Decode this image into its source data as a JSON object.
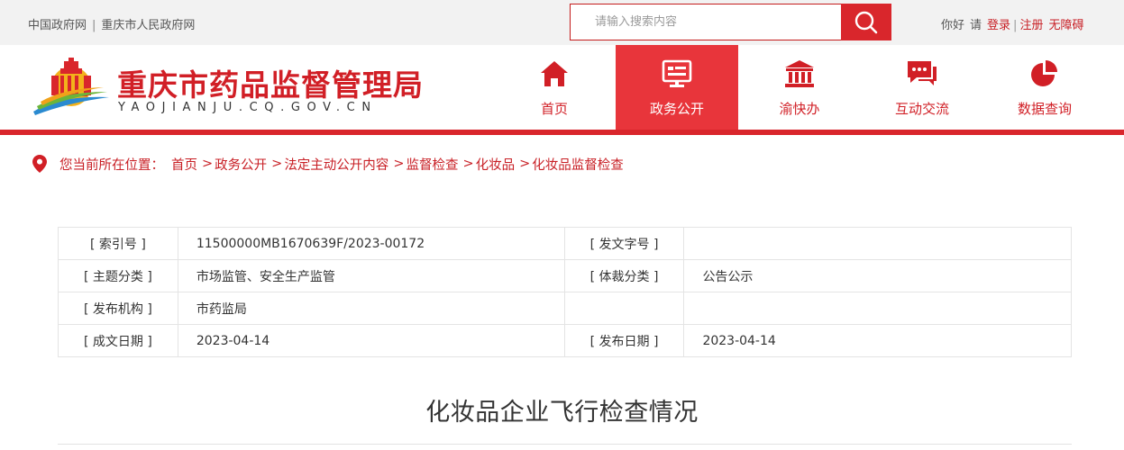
{
  "topbar": {
    "gov_link_1": "中国政府网",
    "gov_separator": "|",
    "gov_link_2": "重庆市人民政府网",
    "search": {
      "placeholder": "请输入搜索内容"
    },
    "user": {
      "greeting": "你好",
      "prompt": "请",
      "login": "登录",
      "separator": "|",
      "register": "注册",
      "accessibility": "无障碍"
    }
  },
  "header": {
    "site_title": "重庆市药品监督管理局",
    "site_domain": "YAOJIANJU.CQ.GOV.CN",
    "nav": [
      {
        "label": "首页",
        "icon": "home-icon",
        "active": false
      },
      {
        "label": "政务公开",
        "icon": "announcement-board-icon",
        "active": true
      },
      {
        "label": "渝快办",
        "icon": "government-building-icon",
        "active": false
      },
      {
        "label": "互动交流",
        "icon": "chat-bubbles-icon",
        "active": false
      },
      {
        "label": "数据查询",
        "icon": "pie-chart-icon",
        "active": false
      }
    ]
  },
  "breadcrumb": {
    "prefix": "您当前所在位置：",
    "items": [
      "首页",
      "政务公开",
      "法定主动公开内容",
      "监督检查",
      "化妆品",
      "化妆品监督检查"
    ],
    "arrow": ">"
  },
  "info_table": {
    "rows": [
      {
        "k1": "[ 索引号 ]",
        "v1": "11500000MB1670639F/2023-00172",
        "k2": "[ 发文字号 ]",
        "v2": ""
      },
      {
        "k1": "[ 主题分类 ]",
        "v1": "市场监管、安全生产监管",
        "k2": "[ 体裁分类 ]",
        "v2": "公告公示"
      },
      {
        "k1": "[ 发布机构 ]",
        "v1": "市药监局",
        "k2": "",
        "v2": ""
      },
      {
        "k1": "[ 成文日期 ]",
        "v1": "2023-04-14",
        "k2": "[ 发布日期 ]",
        "v2": "2023-04-14"
      }
    ]
  },
  "article": {
    "title": "化妆品企业飞行检查情况"
  },
  "colors": {
    "brand_red": "#d11f26",
    "active_nav": "#e8353b",
    "topbar_bg": "#f2f2f2"
  }
}
